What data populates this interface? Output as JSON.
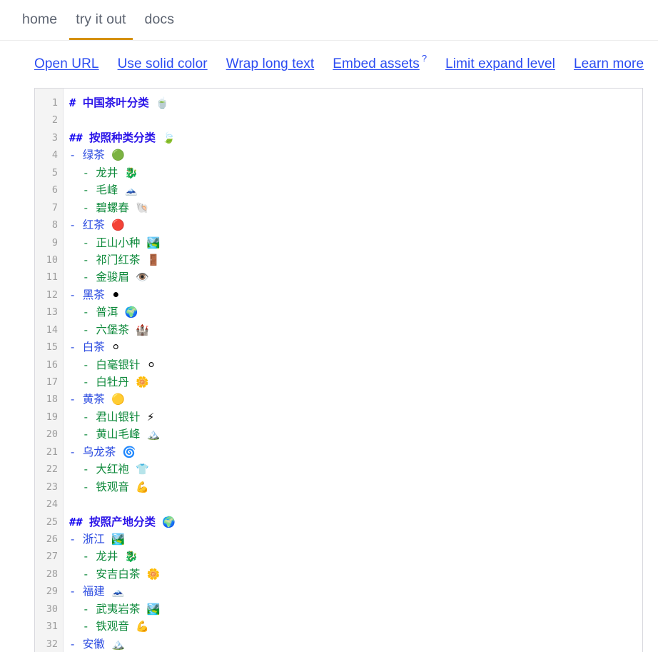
{
  "navbar": {
    "tabs": [
      {
        "label": "home",
        "active": false
      },
      {
        "label": "try it out",
        "active": true
      },
      {
        "label": "docs",
        "active": false
      }
    ],
    "active_underline_color": "#d4900a"
  },
  "toolbar": {
    "links": [
      {
        "label": "Open URL",
        "help": ""
      },
      {
        "label": "Use solid color",
        "help": ""
      },
      {
        "label": "Wrap long text",
        "help": ""
      },
      {
        "label": "Embed assets",
        "help": "?"
      },
      {
        "label": "Limit expand level",
        "help": ""
      },
      {
        "label": "Learn more",
        "help": ""
      }
    ],
    "link_color": "#2b4cf2"
  },
  "editor": {
    "language": "markdown",
    "first_line": 1,
    "total_visible_lines": 32,
    "colors": {
      "gutter_bg": "#f4f4f4",
      "line_number": "#9d9d9d",
      "heading_marker": "#1708f0",
      "heading_text": "#2a13e8",
      "list_level1": "#2a4ae0",
      "list_level2": "#0f8a3c"
    },
    "lines": [
      {
        "n": 1,
        "marker": "#",
        "indent": 0,
        "text": "中国茶叶分类",
        "emoji": "🍵",
        "kind": "h1"
      },
      {
        "n": 2,
        "marker": "",
        "indent": 0,
        "text": "",
        "emoji": "",
        "kind": "blank"
      },
      {
        "n": 3,
        "marker": "##",
        "indent": 0,
        "text": "按照种类分类",
        "emoji": "🍃",
        "kind": "h2"
      },
      {
        "n": 4,
        "marker": "-",
        "indent": 0,
        "text": "绿茶",
        "emoji": "🟢",
        "kind": "li1"
      },
      {
        "n": 5,
        "marker": "-",
        "indent": 1,
        "text": "龙井",
        "emoji": "🐉",
        "kind": "li2"
      },
      {
        "n": 6,
        "marker": "-",
        "indent": 1,
        "text": "毛峰",
        "emoji": "🗻",
        "kind": "li2"
      },
      {
        "n": 7,
        "marker": "-",
        "indent": 1,
        "text": "碧螺春",
        "emoji": "🐚",
        "kind": "li2"
      },
      {
        "n": 8,
        "marker": "-",
        "indent": 0,
        "text": "红茶",
        "emoji": "🔴",
        "kind": "li1"
      },
      {
        "n": 9,
        "marker": "-",
        "indent": 1,
        "text": "正山小种",
        "emoji": "🏞️",
        "kind": "li2"
      },
      {
        "n": 10,
        "marker": "-",
        "indent": 1,
        "text": "祁门红茶",
        "emoji": "🚪",
        "kind": "li2"
      },
      {
        "n": 11,
        "marker": "-",
        "indent": 1,
        "text": "金骏眉",
        "emoji": "👁️",
        "kind": "li2"
      },
      {
        "n": 12,
        "marker": "-",
        "indent": 0,
        "text": "黑茶",
        "emoji": "⚫",
        "kind": "li1"
      },
      {
        "n": 13,
        "marker": "-",
        "indent": 1,
        "text": "普洱",
        "emoji": "🌍",
        "kind": "li2"
      },
      {
        "n": 14,
        "marker": "-",
        "indent": 1,
        "text": "六堡茶",
        "emoji": "🏰",
        "kind": "li2"
      },
      {
        "n": 15,
        "marker": "-",
        "indent": 0,
        "text": "白茶",
        "emoji": "⚪",
        "kind": "li1"
      },
      {
        "n": 16,
        "marker": "-",
        "indent": 1,
        "text": "白毫银针",
        "emoji": "⚪",
        "kind": "li2"
      },
      {
        "n": 17,
        "marker": "-",
        "indent": 1,
        "text": "白牡丹",
        "emoji": "🌼",
        "kind": "li2"
      },
      {
        "n": 18,
        "marker": "-",
        "indent": 0,
        "text": "黄茶",
        "emoji": "🟡",
        "kind": "li1"
      },
      {
        "n": 19,
        "marker": "-",
        "indent": 1,
        "text": "君山银针",
        "emoji": "⚡",
        "kind": "li2"
      },
      {
        "n": 20,
        "marker": "-",
        "indent": 1,
        "text": "黄山毛峰",
        "emoji": "🏔️",
        "kind": "li2"
      },
      {
        "n": 21,
        "marker": "-",
        "indent": 0,
        "text": "乌龙茶",
        "emoji": "🌀",
        "kind": "li1"
      },
      {
        "n": 22,
        "marker": "-",
        "indent": 1,
        "text": "大红袍",
        "emoji": "👕",
        "kind": "li2"
      },
      {
        "n": 23,
        "marker": "-",
        "indent": 1,
        "text": "铁观音",
        "emoji": "💪",
        "kind": "li2"
      },
      {
        "n": 24,
        "marker": "",
        "indent": 0,
        "text": "",
        "emoji": "",
        "kind": "blank"
      },
      {
        "n": 25,
        "marker": "##",
        "indent": 0,
        "text": "按照产地分类",
        "emoji": "🌍",
        "kind": "h2"
      },
      {
        "n": 26,
        "marker": "-",
        "indent": 0,
        "text": "浙江",
        "emoji": "🏞️",
        "kind": "li1"
      },
      {
        "n": 27,
        "marker": "-",
        "indent": 1,
        "text": "龙井",
        "emoji": "🐉",
        "kind": "li2"
      },
      {
        "n": 28,
        "marker": "-",
        "indent": 1,
        "text": "安吉白茶",
        "emoji": "🌼",
        "kind": "li2"
      },
      {
        "n": 29,
        "marker": "-",
        "indent": 0,
        "text": "福建",
        "emoji": "🗻",
        "kind": "li1"
      },
      {
        "n": 30,
        "marker": "-",
        "indent": 1,
        "text": "武夷岩茶",
        "emoji": "🏞️",
        "kind": "li2"
      },
      {
        "n": 31,
        "marker": "-",
        "indent": 1,
        "text": "铁观音",
        "emoji": "💪",
        "kind": "li2"
      },
      {
        "n": 32,
        "marker": "-",
        "indent": 0,
        "text": "安徽",
        "emoji": "🏔️",
        "kind": "li1"
      }
    ]
  }
}
